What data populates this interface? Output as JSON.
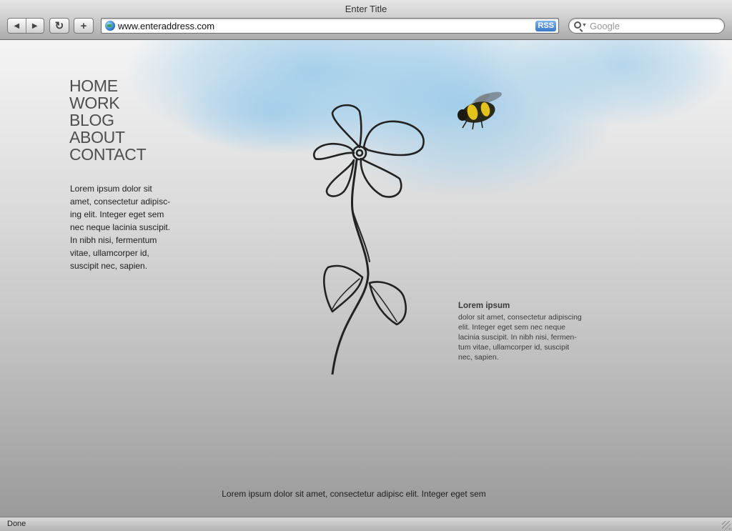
{
  "window": {
    "title": "Enter Title"
  },
  "toolbar": {
    "back_icon": "back-arrow-icon",
    "forward_icon": "forward-arrow-icon",
    "reload_icon": "reload-icon",
    "add_icon": "plus-icon",
    "address": "www.enteraddress.com",
    "rss_label": "RSS",
    "search_placeholder": "Google"
  },
  "page": {
    "nav": [
      "HOME",
      "WORK",
      "BLOG",
      "ABOUT",
      "CONTACT"
    ],
    "intro_lines": [
      "Lorem ipsum dolor sit",
      "amet, consectetur adipisc-",
      "ing elit. Integer eget sem",
      "nec neque lacinia suscipit.",
      "In nibh nisi, fermentum",
      "vitae, ullamcorper id,",
      "suscipit nec, sapien."
    ],
    "side_title": "Lorem ipsum",
    "side_lines": [
      "dolor sit amet, consectetur adipiscing",
      "elit. Integer eget sem nec neque",
      "lacinia suscipit. In nibh nisi, fermen-",
      "tum vitae, ullamcorper id, suscipit",
      "nec, sapien."
    ],
    "footer": "Lorem ipsum dolor sit amet, consectetur adipisc elit. Integer eget sem",
    "illustrations": [
      "flower-sketch",
      "bumblebee"
    ]
  },
  "status": {
    "text": "Done"
  },
  "colors": {
    "sky": "#8cc4e8",
    "nav_text": "#4e4e4e",
    "chrome": "#cfcfcf"
  }
}
